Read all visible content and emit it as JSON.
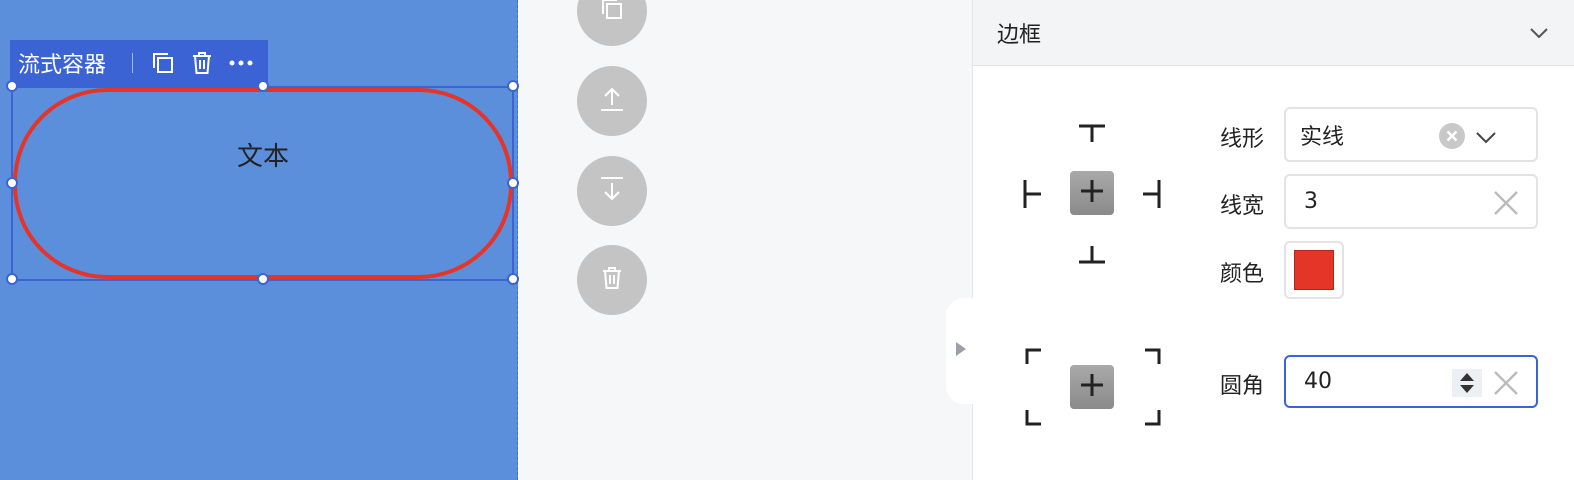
{
  "canvas": {
    "toolbar": {
      "title": "流式容器",
      "icons": [
        "copy-icon",
        "trash-icon",
        "more-icon"
      ]
    },
    "component_text": "文本",
    "background_color": "#5b8fdc",
    "border_color": "#e53528",
    "selection_color": "#3c63d3"
  },
  "floating_actions": [
    {
      "name": "copy-icon"
    },
    {
      "name": "move-up-icon"
    },
    {
      "name": "move-down-icon"
    },
    {
      "name": "delete-icon"
    }
  ],
  "panel": {
    "section_title": "边框",
    "line_style": {
      "label": "线形",
      "value": "实线"
    },
    "line_width": {
      "label": "线宽",
      "value": "3"
    },
    "color": {
      "label": "颜色",
      "value": "#e53528"
    },
    "radius": {
      "label": "圆角",
      "value": "40"
    }
  }
}
